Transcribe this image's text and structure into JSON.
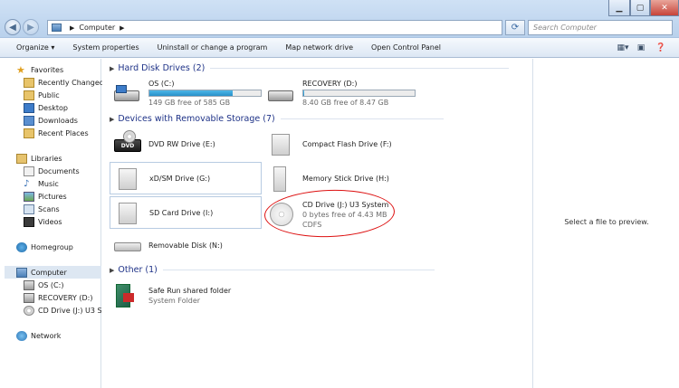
{
  "address": {
    "crumb": "Computer"
  },
  "search": {
    "placeholder": "Search Computer"
  },
  "toolbar": {
    "organize": "Organize ▾",
    "system_properties": "System properties",
    "uninstall": "Uninstall or change a program",
    "map_drive": "Map network drive",
    "control_panel": "Open Control Panel"
  },
  "nav": {
    "favorites": "Favorites",
    "recently_changed": "Recently Changed",
    "public": "Public",
    "desktop": "Desktop",
    "downloads": "Downloads",
    "recent_places": "Recent Places",
    "libraries": "Libraries",
    "documents": "Documents",
    "music": "Music",
    "pictures": "Pictures",
    "scans": "Scans",
    "videos": "Videos",
    "homegroup": "Homegroup",
    "computer": "Computer",
    "os_c": "OS (C:)",
    "recovery_d": "RECOVERY (D:)",
    "cd_drive": "CD Drive (J:) U3 System",
    "network": "Network"
  },
  "groups": {
    "hdd": "Hard Disk Drives (2)",
    "removable": "Devices with Removable Storage (7)",
    "other": "Other (1)"
  },
  "drives": {
    "os": {
      "name": "OS (C:)",
      "free": "149 GB free of 585 GB",
      "used_fraction": 0.75
    },
    "recovery": {
      "name": "RECOVERY (D:)",
      "free": "8.40 GB free of 8.47 GB",
      "used_fraction": 0.01
    },
    "dvd": {
      "name": "DVD RW Drive (E:)"
    },
    "cf": {
      "name": "Compact Flash Drive (F:)"
    },
    "xd": {
      "name": "xD/SM Drive (G:)"
    },
    "ms": {
      "name": "Memory Stick Drive (H:)"
    },
    "sd": {
      "name": "SD Card Drive (I:)"
    },
    "cd": {
      "name": "CD Drive (J:) U3 System",
      "free": "0 bytes free of 4.43 MB",
      "fs": "CDFS"
    },
    "removable": {
      "name": "Removable Disk (N:)"
    }
  },
  "other": {
    "safe_run": {
      "name": "Safe Run shared folder",
      "type": "System Folder"
    }
  },
  "preview": {
    "message": "Select a file to preview."
  },
  "colors": {
    "accent": "#1e3287",
    "bar_fill": "#2790c9",
    "annotation": "#dd1111"
  }
}
